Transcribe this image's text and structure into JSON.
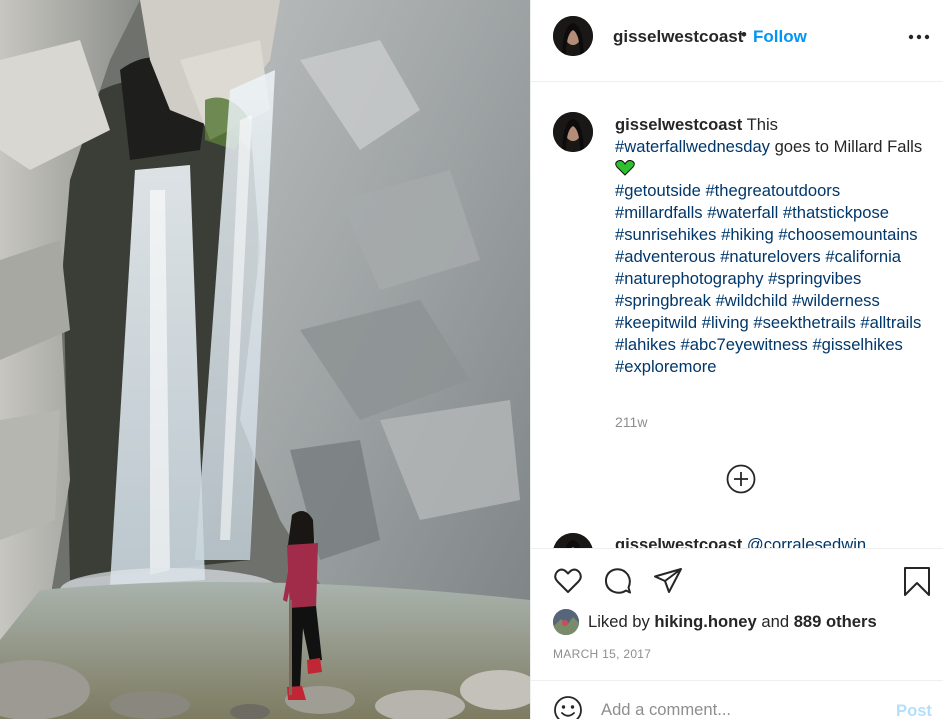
{
  "colors": {
    "link": "#0095f6",
    "hashtag": "#00376b",
    "muted": "#8e8e8e",
    "text": "#262626",
    "post_disabled": "#b2dffc",
    "heart_emoji": "#2ec12e"
  },
  "post": {
    "username": "gisselwestcoast",
    "dot": "•",
    "follow_label": "Follow",
    "more_icon": "more-horizontal-icon"
  },
  "caption": {
    "username": "gisselwestcoast",
    "text_lead": " This ",
    "hashtag_1": "#waterfallwednesday",
    "text_mid": " goes to Millard Falls",
    "emoji": "green-heart-icon",
    "hashtags": [
      "#getoutside",
      "#thegreatoutdoors",
      "#millardfalls",
      "#waterfall",
      "#thatstickpose",
      "#sunrisehikes",
      "#hiking",
      "#choosemountains",
      "#adventerous",
      "#naturelovers",
      "#california",
      "#naturephotography",
      "#springvibes",
      "#springbreak",
      "#wildchild",
      "#wilderness",
      "#keepitwild",
      "#living",
      "#seekthetrails",
      "#alltrails",
      "#lahikes",
      "#abc7eyewitness",
      "#gisselhikes",
      "#exploremore"
    ],
    "age": "211w"
  },
  "load_more_icon": "plus-circle-icon",
  "next_comment": {
    "username": "gisselwestcoast",
    "mention": "@corralesedwin"
  },
  "actions": {
    "like": "heart-icon",
    "comment": "comment-icon",
    "share": "share-icon",
    "save": "bookmark-icon"
  },
  "likes": {
    "prefix": "Liked by ",
    "user": "hiking.honey",
    "middle": " and ",
    "others": "889 others"
  },
  "date": "MARCH 15, 2017",
  "comment_box": {
    "placeholder": "Add a comment...",
    "post_label": "Post",
    "emoji_icon": "smiley-icon"
  }
}
